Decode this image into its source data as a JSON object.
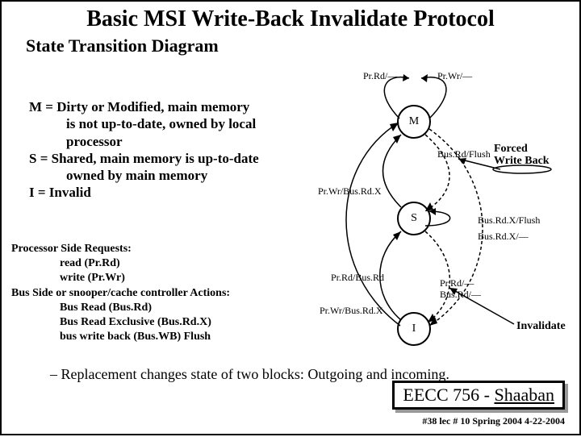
{
  "title": "Basic MSI Write-Back Invalidate Protocol",
  "subtitle": "State Transition Diagram",
  "def": {
    "l1": "M = Dirty or Modified, main memory",
    "l2": "is not up-to-date, owned by local",
    "l3": "processor",
    "l4": "S = Shared, main memory is up-to-date",
    "l5": "owned by main memory",
    "l6": "I =   Invalid"
  },
  "req": {
    "h1": "Processor Side Requests:",
    "r1": "read  (Pr.Rd)",
    "r2": "write (Pr.Wr)",
    "h2": "Bus Side or snooper/cache controller Actions:",
    "r3": "Bus Read (Bus.Rd)",
    "r4": "Bus Read Exclusive (Bus.Rd.X)",
    "r5": "bus write back (Bus.WB)  Flush"
  },
  "repl": "–   Replacement changes state of two blocks: Outgoing and incoming.",
  "footer": {
    "a": "EECC 756 - ",
    "b": "Shaaban"
  },
  "subf": "#38    lec # 10    Spring 2004    4-22-2004",
  "states": {
    "m": "M",
    "s": "S",
    "i": "I"
  },
  "labels": {
    "prrd": "Pr.Rd/—",
    "prwr": "Pr.Wr/—",
    "busrdflush": "Bus.Rd/Flush",
    "prwrbusrdx": "Pr.Wr/Bus.Rd.X",
    "busrdxflush": "Bus.Rd.X/Flush",
    "busrdx_": "Bus.Rd.X/—",
    "prrdbusrd": "Pr.Rd/Bus.Rd",
    "prwrbusrdx2": "Pr.Wr/Bus.Rd.X",
    "prrd_": "Pr.Rd/—",
    "busrd_": "Bus.Rd/—"
  },
  "forced": {
    "a": "Forced",
    "b": "Write Back"
  },
  "inval": "Invalidate"
}
